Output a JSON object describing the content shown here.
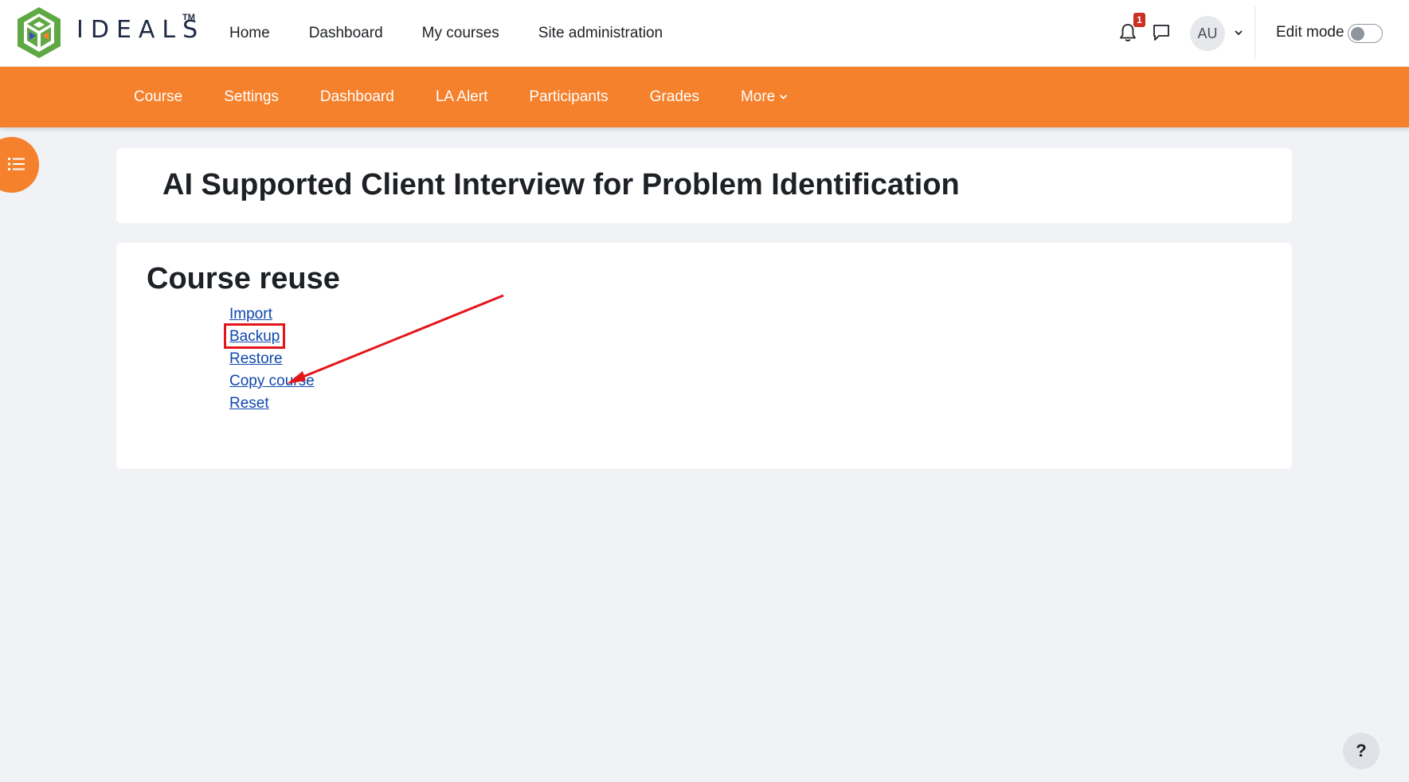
{
  "brand": {
    "name": "IDEALS",
    "tm": "TM"
  },
  "primary_nav": [
    "Home",
    "Dashboard",
    "My courses",
    "Site administration"
  ],
  "notifications": {
    "count": "1"
  },
  "user": {
    "initials": "AU"
  },
  "edit_mode": {
    "label": "Edit mode",
    "enabled": false
  },
  "secondary_nav": {
    "items": [
      "Course",
      "Settings",
      "Dashboard",
      "LA Alert",
      "Participants",
      "Grades"
    ],
    "more": "More"
  },
  "page": {
    "title": "AI Supported Client Interview for Problem Identification"
  },
  "course_reuse": {
    "title": "Course reuse",
    "links": [
      "Import",
      "Backup",
      "Restore",
      "Copy course",
      "Reset"
    ]
  },
  "help": {
    "label": "?"
  },
  "colors": {
    "accent": "#f5812c",
    "link": "#0f47ad",
    "annotation": "#e3151a",
    "badge": "#ca3120"
  },
  "icons": [
    "bell-icon",
    "message-icon",
    "chevron-down-icon",
    "list-icon",
    "help-icon"
  ]
}
